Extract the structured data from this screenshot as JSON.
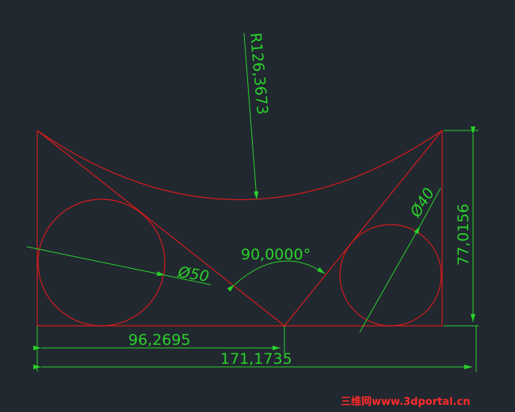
{
  "colors": {
    "background": "#212830",
    "geometry": "#d41c1c",
    "dimension": "#2ad12a",
    "watermark": "#ff2a2a"
  },
  "dimensions": {
    "arc_radius": "R126,3673",
    "left_circle_diameter": "Ø50",
    "right_circle_diameter": "Ø40",
    "angle": "90,0000°",
    "height": "77,0156",
    "width_partial": "96,2695",
    "width_total": "171,1735"
  },
  "watermark": "三维网www.3dportal.cn"
}
